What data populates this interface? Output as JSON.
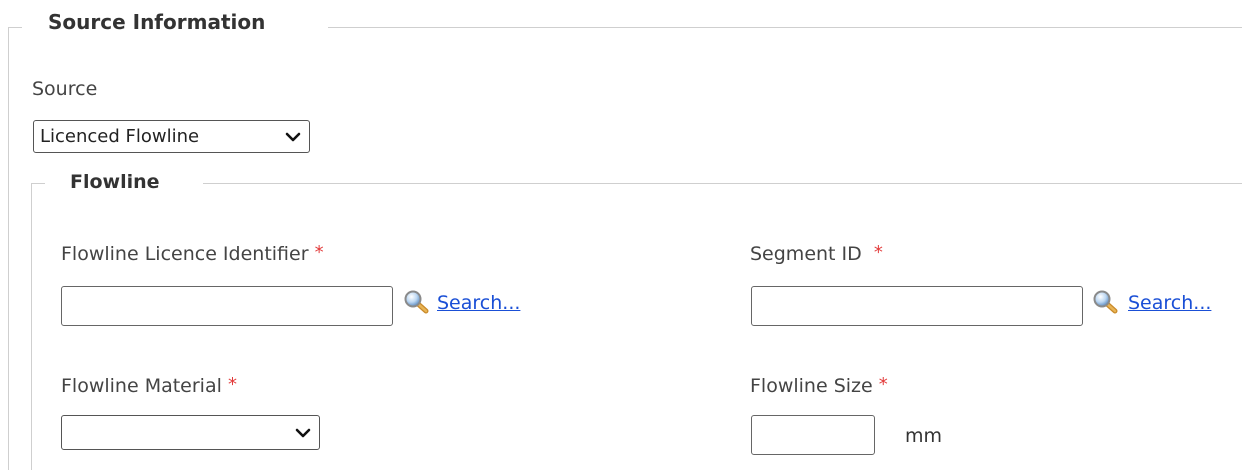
{
  "source_section": {
    "legend": "Source Information",
    "source_label": "Source",
    "source_select": {
      "selected": "Licenced Flowline"
    }
  },
  "flowline_section": {
    "legend": "Flowline",
    "licence_identifier": {
      "label": "Flowline Licence Identifier",
      "required_marker": "*",
      "value": "",
      "search_label": "Search..."
    },
    "segment_id": {
      "label": "Segment ID",
      "required_marker": "*",
      "value": "",
      "search_label": "Search..."
    },
    "material": {
      "label": "Flowline Material",
      "required_marker": "*",
      "selected": ""
    },
    "size": {
      "label": "Flowline Size",
      "required_marker": "*",
      "value": "",
      "unit": "mm"
    }
  },
  "colors": {
    "required": "#e23b3b",
    "link": "#1a4fd6",
    "border": "#cfcfcf"
  }
}
